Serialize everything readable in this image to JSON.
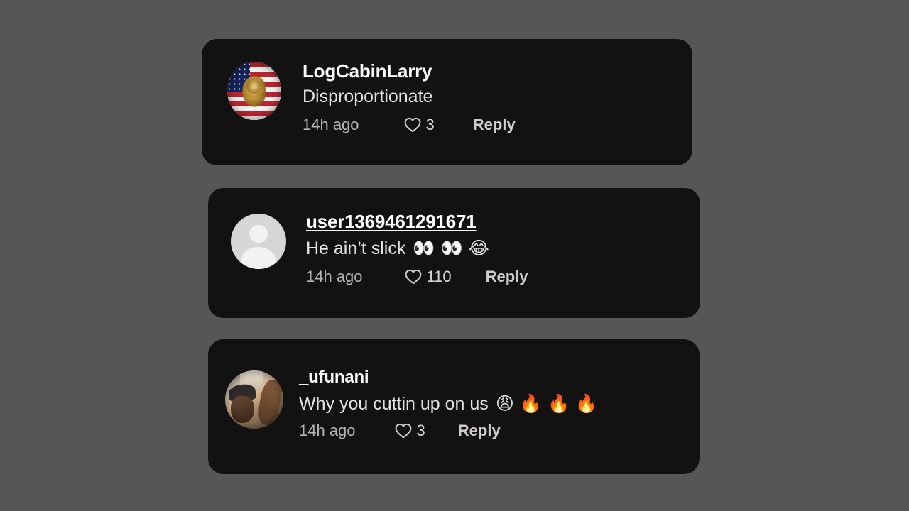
{
  "theme": {
    "page_background": "#565656",
    "card_background": "#121212",
    "username_color": "#ffffff",
    "comment_text_color": "#e3e3e3",
    "meta_text_color": "#b6b3b0",
    "reply_color": "#cfccc9"
  },
  "comments": [
    {
      "username": "LogCabinLarry",
      "text": "Disproportionate",
      "timestamp": "14h ago",
      "like_count": "3",
      "reply_label": "Reply",
      "avatar_type": "us-flag-eagle-photo",
      "username_underlined": false,
      "emojis": []
    },
    {
      "username": "user1369461291671",
      "text": "He ain’t slick",
      "timestamp": "14h ago",
      "like_count": "110",
      "reply_label": "Reply",
      "avatar_type": "default-placeholder",
      "username_underlined": true,
      "emojis": [
        "👀",
        "👀",
        "😂"
      ]
    },
    {
      "username": "_ufunani",
      "text": "Why you cuttin up on us",
      "timestamp": "14h ago",
      "like_count": "3",
      "reply_label": "Reply",
      "avatar_type": "person-photo",
      "username_underlined": false,
      "emojis": [
        "😩",
        "🔥",
        "🔥",
        "🔥"
      ]
    }
  ],
  "icons": {
    "heart": "heart-outline-icon"
  }
}
